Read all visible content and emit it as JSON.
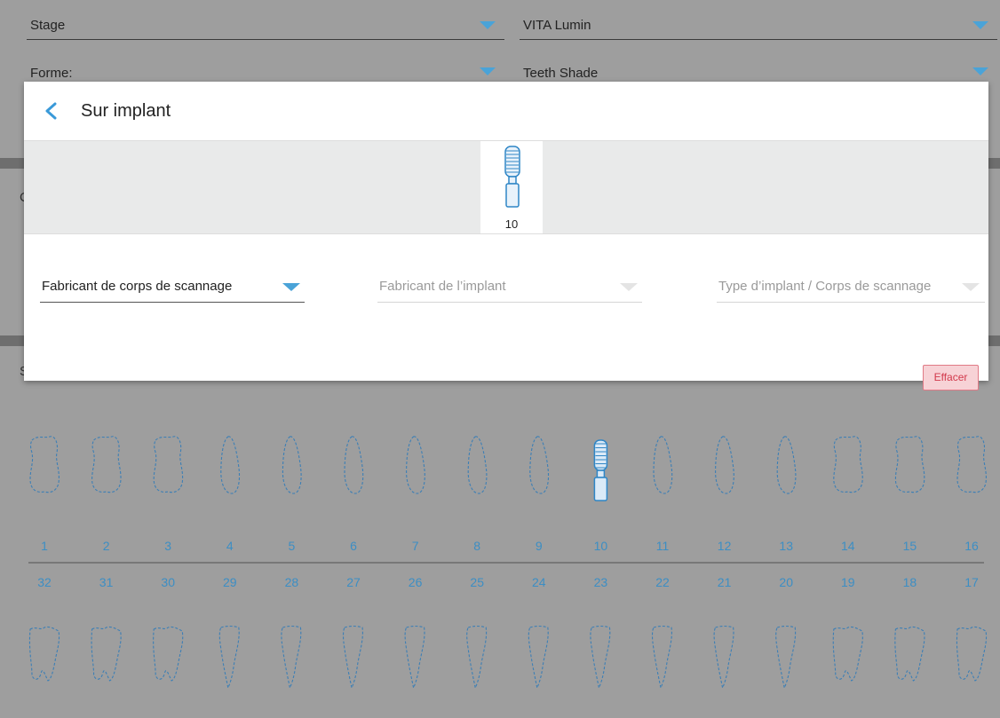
{
  "background_form": {
    "stage_label": "Stage",
    "shade_system_value": "VITA Lumin",
    "shape_label": "Forme:",
    "teeth_shade_label": "Teeth Shade",
    "partial_letter_1": "C",
    "partial_letter_2": "S"
  },
  "dialog": {
    "title": "Sur implant",
    "selected_tooth": "10",
    "scanbody_manufacturer_placeholder": "Fabricant de corps de scannage",
    "implant_manufacturer_placeholder": "Fabricant de l’implant",
    "implant_type_placeholder": "Type d’implant / Corps de scannage",
    "clear_label": "Effacer"
  },
  "teeth_chart": {
    "upper_numbers": [
      "1",
      "2",
      "3",
      "4",
      "5",
      "6",
      "7",
      "8",
      "9",
      "10",
      "11",
      "12",
      "13",
      "14",
      "15",
      "16"
    ],
    "lower_numbers": [
      "32",
      "31",
      "30",
      "29",
      "28",
      "27",
      "26",
      "25",
      "24",
      "23",
      "22",
      "21",
      "20",
      "19",
      "18",
      "17"
    ],
    "implant_tooth": "10"
  },
  "colors": {
    "accent": "#4aa3d8",
    "clear_button": "#f7d2d6"
  }
}
